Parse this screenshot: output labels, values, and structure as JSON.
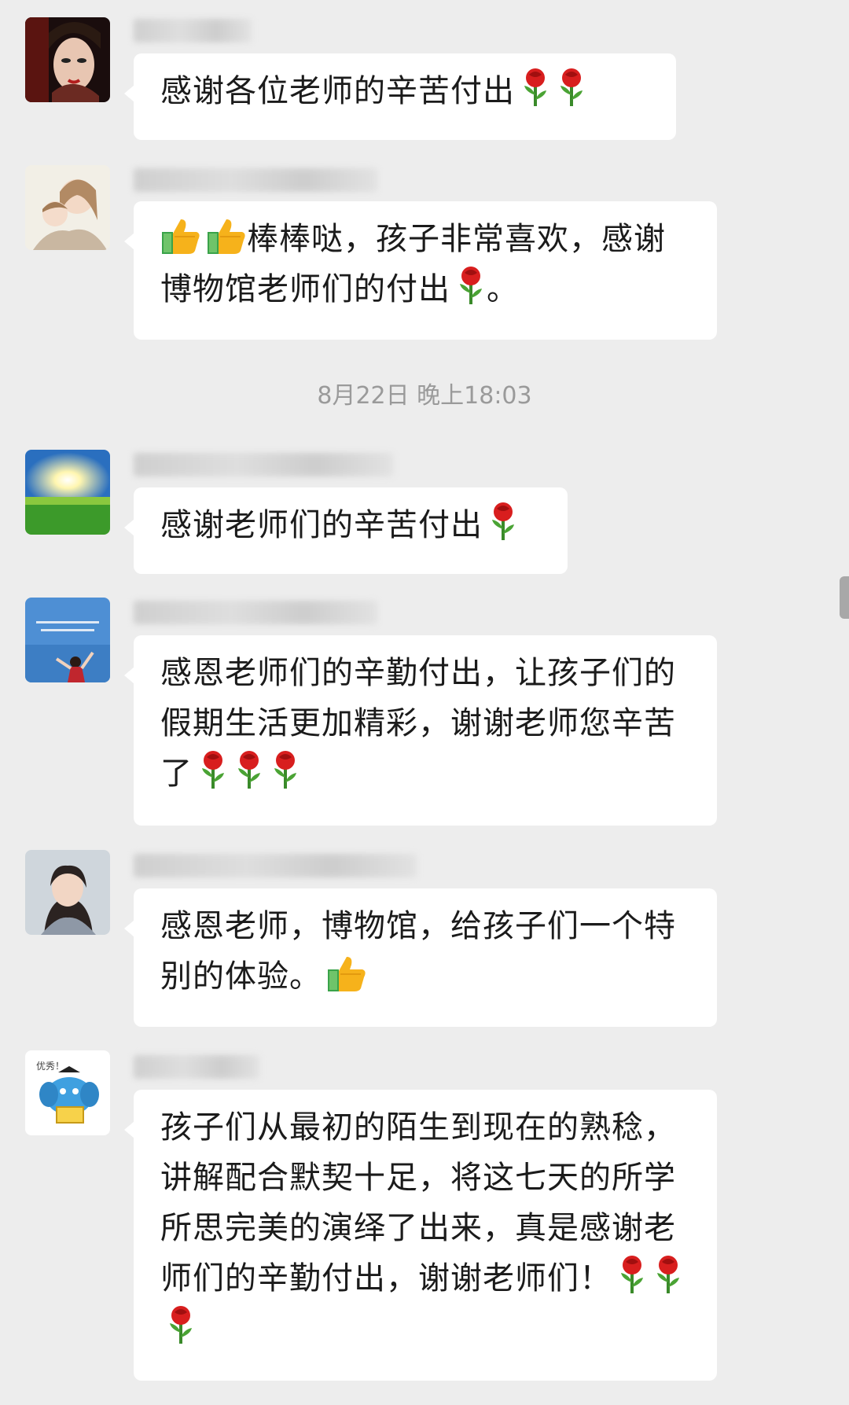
{
  "timestamp": "8月22日 晚上18:03",
  "messages": [
    {
      "text": "感谢各位老师的辛苦付出",
      "avatar": "opera-mask-avatar"
    },
    {
      "text_prefix": "",
      "text": "棒棒哒，孩子非常喜欢，感谢博物馆老师们的付出",
      "text_suffix": "。",
      "avatar": "mother-child-avatar"
    },
    {
      "text": "感谢老师们的辛苦付出",
      "avatar": "sunrise-field-avatar"
    },
    {
      "text": "感恩老师们的辛勤付出，让孩子们的假期生活更加精彩，谢谢老师您辛苦了",
      "avatar": "girl-sky-avatar"
    },
    {
      "text": "感恩老师，博物馆，给孩子们一个特别的体验。",
      "avatar": "woman-portrait-avatar"
    },
    {
      "text": "孩子们从最初的陌生到现在的熟稔，讲解配合默契十足，将这七天的所学所思完美的演绎了出来，真是感谢老师们的辛勤付出，谢谢老师们！",
      "avatar": "elephant-cartoon-avatar"
    }
  ],
  "avatar_text": {
    "elephant_caption": "优秀！"
  },
  "icons": [
    "rose-emoji",
    "thumbs-up-emoji"
  ],
  "colors": {
    "background": "#ededed",
    "bubble": "#ffffff",
    "text": "#1b1b1b",
    "timestamp": "#9a9a9a"
  }
}
